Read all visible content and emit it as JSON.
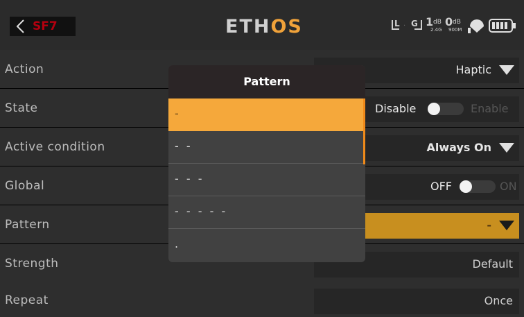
{
  "header": {
    "screen_title": "SF7",
    "brand": {
      "main": "ETH",
      "accent": "OS"
    },
    "status": {
      "l_label": "L",
      "g_label": "G",
      "rssi_1": "1",
      "rssi_1_unit": "dB",
      "band_1": "2.4G",
      "rssi_2": "0",
      "rssi_2_unit": "dB",
      "band_2": "900M"
    }
  },
  "rows": {
    "action": {
      "label": "Action",
      "value": "Haptic"
    },
    "state": {
      "label": "State",
      "off": "Disable",
      "on": "Enable"
    },
    "active_condition": {
      "label": "Active condition",
      "value": "Always On"
    },
    "global": {
      "label": "Global",
      "off": "OFF",
      "on": "ON"
    },
    "pattern": {
      "label": "Pattern",
      "value": "-"
    },
    "strength": {
      "label": "Strength",
      "value": "Default"
    },
    "repeat": {
      "label": "Repeat",
      "value": "Once"
    }
  },
  "popup": {
    "title": "Pattern",
    "options": [
      "-",
      "- -",
      "- - -",
      "- - - - -",
      "."
    ],
    "selected_index": 0
  },
  "colors": {
    "accent": "#f5a83b",
    "title_red": "#b3000f",
    "selected_field": "#c88f1f",
    "background": "#2e2e2e"
  },
  "icons": [
    "back-chevron-icon",
    "dropdown-arrow-icon",
    "antenna-icon",
    "battery-icon"
  ]
}
